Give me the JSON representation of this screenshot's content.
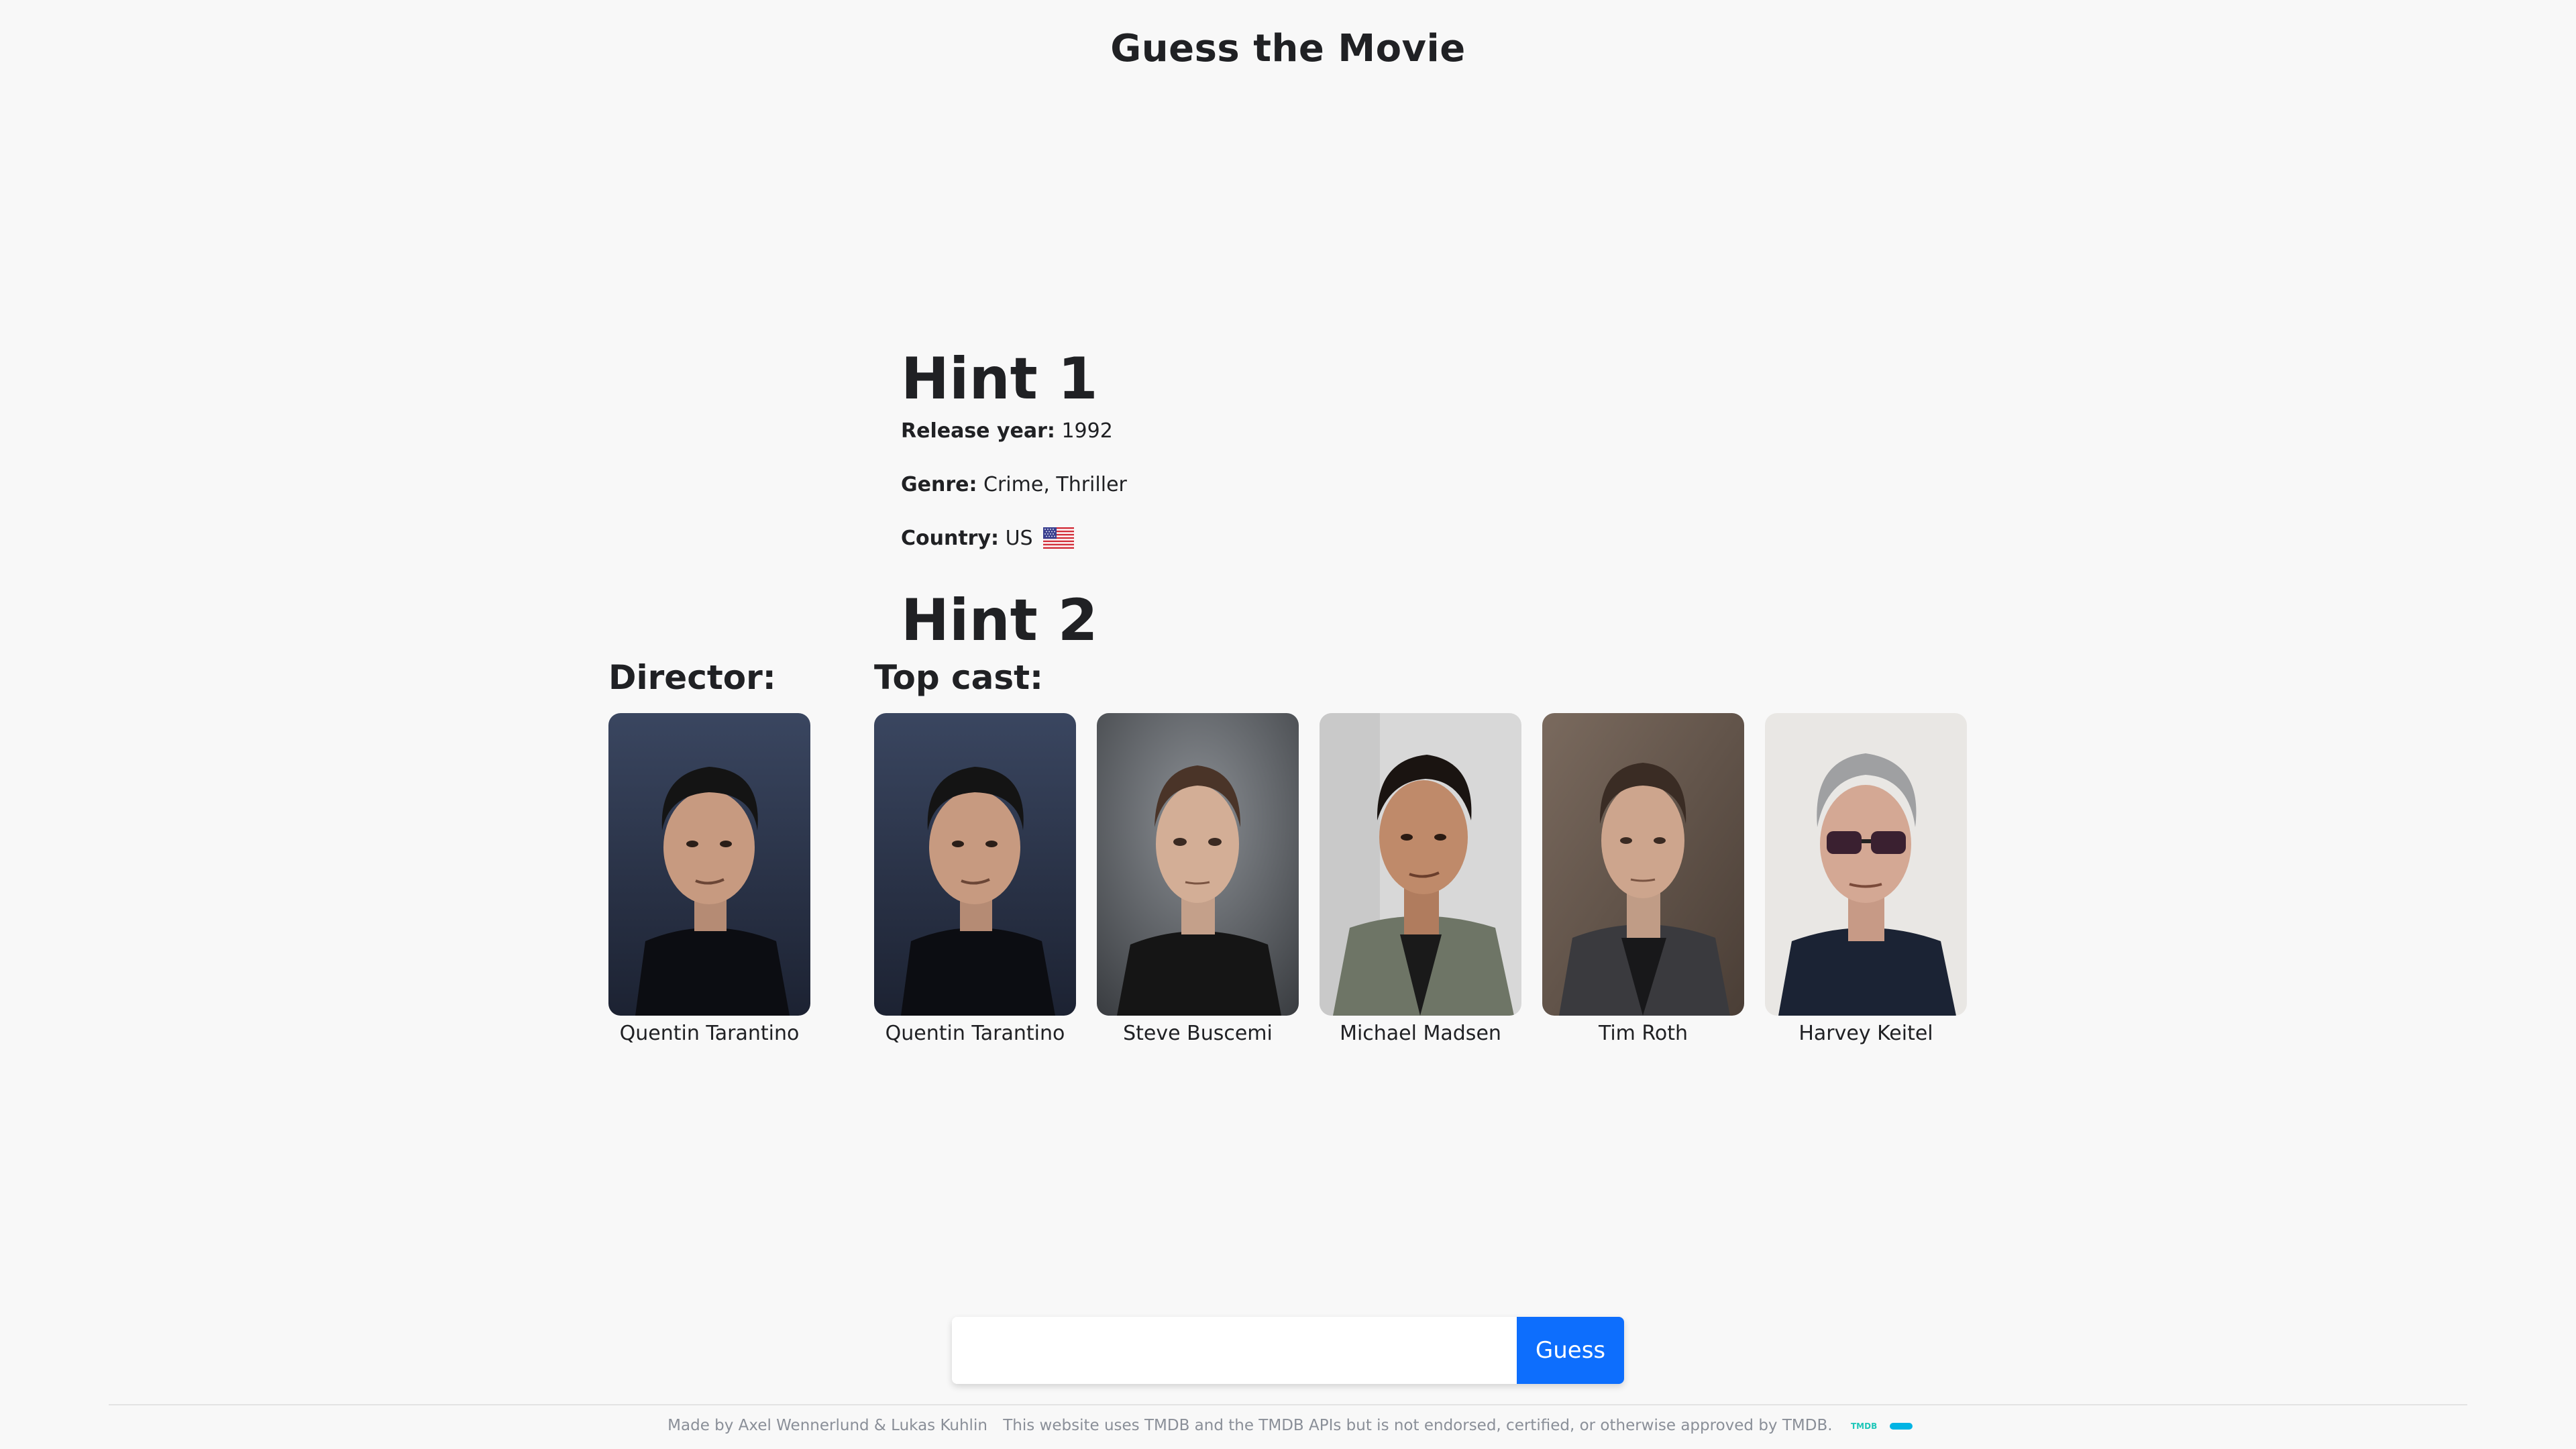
{
  "header": {
    "title": "Guess the Movie"
  },
  "hint1": {
    "heading": "Hint 1",
    "release_label": "Release year:",
    "release_value": "1992",
    "genre_label": "Genre:",
    "genre_value": "Crime, Thriller",
    "country_label": "Country:",
    "country_value": "US",
    "flag_icon": "us-flag-icon"
  },
  "hint2": {
    "heading": "Hint 2",
    "director_label": "Director:",
    "cast_label": "Top cast:",
    "director": {
      "name": "Quentin Tarantino"
    },
    "cast": [
      {
        "name": "Quentin Tarantino"
      },
      {
        "name": "Steve Buscemi"
      },
      {
        "name": "Michael Madsen"
      },
      {
        "name": "Tim Roth"
      },
      {
        "name": "Harvey Keitel"
      }
    ]
  },
  "guess": {
    "input_value": "",
    "placeholder": "",
    "button_label": "Guess"
  },
  "footer": {
    "credits": "Made by Axel Wennerlund & Lukas Kuhlin",
    "disclaimer": "This website uses TMDB and the TMDB APIs but is not endorsed, certified, or otherwise approved by TMDB.",
    "logo_text": "TMDB"
  },
  "colors": {
    "accent": "#0d6efd",
    "background": "#f8f8f8",
    "text": "#202124",
    "tmdb_teal": "#01b4e4"
  }
}
